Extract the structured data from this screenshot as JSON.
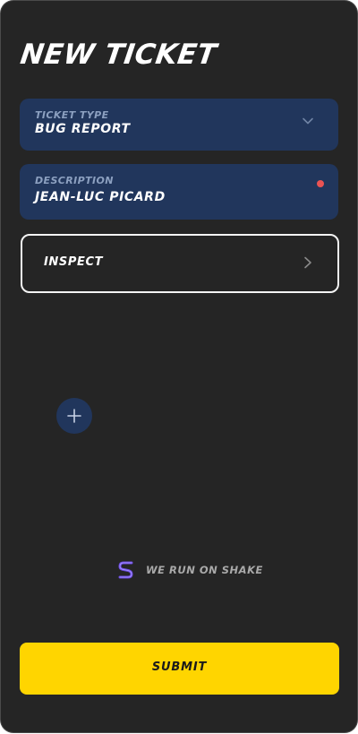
{
  "page": {
    "title": "NEW TICKET"
  },
  "form": {
    "ticket_type": {
      "label": "TICKET TYPE",
      "value": "BUG REPORT"
    },
    "description": {
      "label": "DESCRIPTION",
      "value": "JEAN-LUC PICARD",
      "required_indicator_color": "#ea5353"
    },
    "inspect": {
      "label": "INSPECT"
    },
    "add_attachment": {
      "icon": "plus-icon"
    }
  },
  "footer": {
    "powered_by": "WE RUN ON SHAKE",
    "logo_icon": "shake-logo-icon"
  },
  "actions": {
    "submit_label": "SUBMIT"
  },
  "colors": {
    "background": "#252525",
    "field_background": "#21365c",
    "accent": "#ffd500",
    "required": "#ea5353"
  }
}
